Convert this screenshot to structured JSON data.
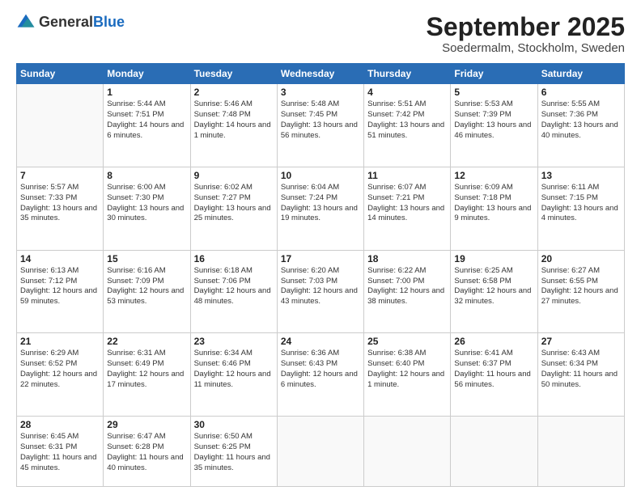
{
  "logo": {
    "general": "General",
    "blue": "Blue"
  },
  "header": {
    "month": "September 2025",
    "location": "Soedermalm, Stockholm, Sweden"
  },
  "weekdays": [
    "Sunday",
    "Monday",
    "Tuesday",
    "Wednesday",
    "Thursday",
    "Friday",
    "Saturday"
  ],
  "weeks": [
    [
      {
        "day": "",
        "empty": true
      },
      {
        "day": "1",
        "sunrise": "Sunrise: 5:44 AM",
        "sunset": "Sunset: 7:51 PM",
        "daylight": "Daylight: 14 hours and 6 minutes."
      },
      {
        "day": "2",
        "sunrise": "Sunrise: 5:46 AM",
        "sunset": "Sunset: 7:48 PM",
        "daylight": "Daylight: 14 hours and 1 minute."
      },
      {
        "day": "3",
        "sunrise": "Sunrise: 5:48 AM",
        "sunset": "Sunset: 7:45 PM",
        "daylight": "Daylight: 13 hours and 56 minutes."
      },
      {
        "day": "4",
        "sunrise": "Sunrise: 5:51 AM",
        "sunset": "Sunset: 7:42 PM",
        "daylight": "Daylight: 13 hours and 51 minutes."
      },
      {
        "day": "5",
        "sunrise": "Sunrise: 5:53 AM",
        "sunset": "Sunset: 7:39 PM",
        "daylight": "Daylight: 13 hours and 46 minutes."
      },
      {
        "day": "6",
        "sunrise": "Sunrise: 5:55 AM",
        "sunset": "Sunset: 7:36 PM",
        "daylight": "Daylight: 13 hours and 40 minutes."
      }
    ],
    [
      {
        "day": "7",
        "sunrise": "Sunrise: 5:57 AM",
        "sunset": "Sunset: 7:33 PM",
        "daylight": "Daylight: 13 hours and 35 minutes."
      },
      {
        "day": "8",
        "sunrise": "Sunrise: 6:00 AM",
        "sunset": "Sunset: 7:30 PM",
        "daylight": "Daylight: 13 hours and 30 minutes."
      },
      {
        "day": "9",
        "sunrise": "Sunrise: 6:02 AM",
        "sunset": "Sunset: 7:27 PM",
        "daylight": "Daylight: 13 hours and 25 minutes."
      },
      {
        "day": "10",
        "sunrise": "Sunrise: 6:04 AM",
        "sunset": "Sunset: 7:24 PM",
        "daylight": "Daylight: 13 hours and 19 minutes."
      },
      {
        "day": "11",
        "sunrise": "Sunrise: 6:07 AM",
        "sunset": "Sunset: 7:21 PM",
        "daylight": "Daylight: 13 hours and 14 minutes."
      },
      {
        "day": "12",
        "sunrise": "Sunrise: 6:09 AM",
        "sunset": "Sunset: 7:18 PM",
        "daylight": "Daylight: 13 hours and 9 minutes."
      },
      {
        "day": "13",
        "sunrise": "Sunrise: 6:11 AM",
        "sunset": "Sunset: 7:15 PM",
        "daylight": "Daylight: 13 hours and 4 minutes."
      }
    ],
    [
      {
        "day": "14",
        "sunrise": "Sunrise: 6:13 AM",
        "sunset": "Sunset: 7:12 PM",
        "daylight": "Daylight: 12 hours and 59 minutes."
      },
      {
        "day": "15",
        "sunrise": "Sunrise: 6:16 AM",
        "sunset": "Sunset: 7:09 PM",
        "daylight": "Daylight: 12 hours and 53 minutes."
      },
      {
        "day": "16",
        "sunrise": "Sunrise: 6:18 AM",
        "sunset": "Sunset: 7:06 PM",
        "daylight": "Daylight: 12 hours and 48 minutes."
      },
      {
        "day": "17",
        "sunrise": "Sunrise: 6:20 AM",
        "sunset": "Sunset: 7:03 PM",
        "daylight": "Daylight: 12 hours and 43 minutes."
      },
      {
        "day": "18",
        "sunrise": "Sunrise: 6:22 AM",
        "sunset": "Sunset: 7:00 PM",
        "daylight": "Daylight: 12 hours and 38 minutes."
      },
      {
        "day": "19",
        "sunrise": "Sunrise: 6:25 AM",
        "sunset": "Sunset: 6:58 PM",
        "daylight": "Daylight: 12 hours and 32 minutes."
      },
      {
        "day": "20",
        "sunrise": "Sunrise: 6:27 AM",
        "sunset": "Sunset: 6:55 PM",
        "daylight": "Daylight: 12 hours and 27 minutes."
      }
    ],
    [
      {
        "day": "21",
        "sunrise": "Sunrise: 6:29 AM",
        "sunset": "Sunset: 6:52 PM",
        "daylight": "Daylight: 12 hours and 22 minutes."
      },
      {
        "day": "22",
        "sunrise": "Sunrise: 6:31 AM",
        "sunset": "Sunset: 6:49 PM",
        "daylight": "Daylight: 12 hours and 17 minutes."
      },
      {
        "day": "23",
        "sunrise": "Sunrise: 6:34 AM",
        "sunset": "Sunset: 6:46 PM",
        "daylight": "Daylight: 12 hours and 11 minutes."
      },
      {
        "day": "24",
        "sunrise": "Sunrise: 6:36 AM",
        "sunset": "Sunset: 6:43 PM",
        "daylight": "Daylight: 12 hours and 6 minutes."
      },
      {
        "day": "25",
        "sunrise": "Sunrise: 6:38 AM",
        "sunset": "Sunset: 6:40 PM",
        "daylight": "Daylight: 12 hours and 1 minute."
      },
      {
        "day": "26",
        "sunrise": "Sunrise: 6:41 AM",
        "sunset": "Sunset: 6:37 PM",
        "daylight": "Daylight: 11 hours and 56 minutes."
      },
      {
        "day": "27",
        "sunrise": "Sunrise: 6:43 AM",
        "sunset": "Sunset: 6:34 PM",
        "daylight": "Daylight: 11 hours and 50 minutes."
      }
    ],
    [
      {
        "day": "28",
        "sunrise": "Sunrise: 6:45 AM",
        "sunset": "Sunset: 6:31 PM",
        "daylight": "Daylight: 11 hours and 45 minutes."
      },
      {
        "day": "29",
        "sunrise": "Sunrise: 6:47 AM",
        "sunset": "Sunset: 6:28 PM",
        "daylight": "Daylight: 11 hours and 40 minutes."
      },
      {
        "day": "30",
        "sunrise": "Sunrise: 6:50 AM",
        "sunset": "Sunset: 6:25 PM",
        "daylight": "Daylight: 11 hours and 35 minutes."
      },
      {
        "day": "",
        "empty": true
      },
      {
        "day": "",
        "empty": true
      },
      {
        "day": "",
        "empty": true
      },
      {
        "day": "",
        "empty": true
      }
    ]
  ]
}
